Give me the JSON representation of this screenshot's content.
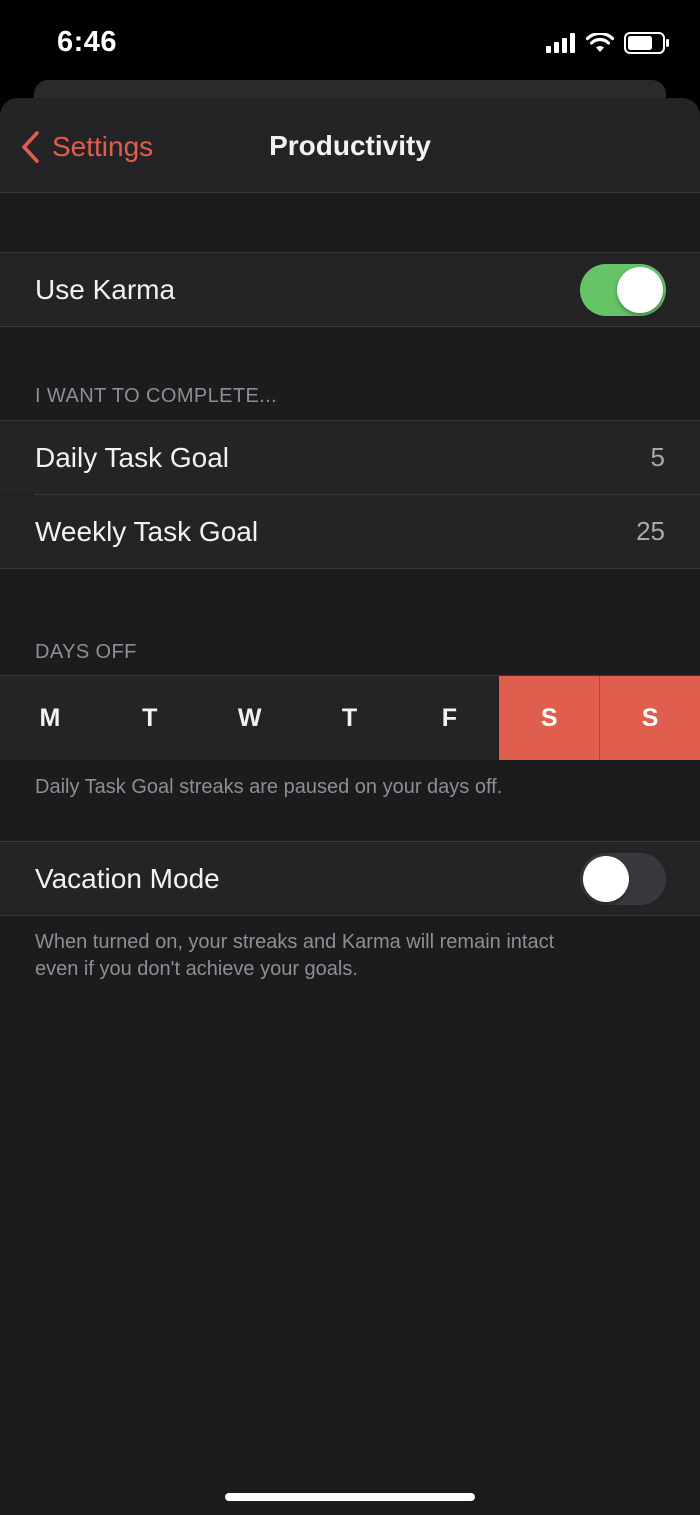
{
  "status_bar": {
    "time": "6:46"
  },
  "nav": {
    "back_label": "Settings",
    "title": "Productivity"
  },
  "karma": {
    "label": "Use Karma",
    "enabled": true
  },
  "goals": {
    "header": "I WANT TO COMPLETE...",
    "daily": {
      "label": "Daily Task Goal",
      "value": "5"
    },
    "weekly": {
      "label": "Weekly Task Goal",
      "value": "25"
    }
  },
  "days_off": {
    "header": "DAYS OFF",
    "days": [
      {
        "label": "M",
        "off": false
      },
      {
        "label": "T",
        "off": false
      },
      {
        "label": "W",
        "off": false
      },
      {
        "label": "T",
        "off": false
      },
      {
        "label": "F",
        "off": false
      },
      {
        "label": "S",
        "off": true
      },
      {
        "label": "S",
        "off": true
      }
    ],
    "accent_color": "#e05e4e",
    "note": "Daily Task Goal streaks are paused on your days off."
  },
  "vacation": {
    "label": "Vacation Mode",
    "enabled": false,
    "note_line1": "When turned on, your streaks and Karma will remain intact",
    "note_line2": "even if you don't achieve your goals."
  },
  "colors": {
    "accent": "#e05e4e",
    "toggle_on": "#64c466",
    "background": "#1c1c1e"
  },
  "icons": [
    "cellular-signal-icon",
    "wifi-icon",
    "battery-icon",
    "chevron-left-icon"
  ]
}
